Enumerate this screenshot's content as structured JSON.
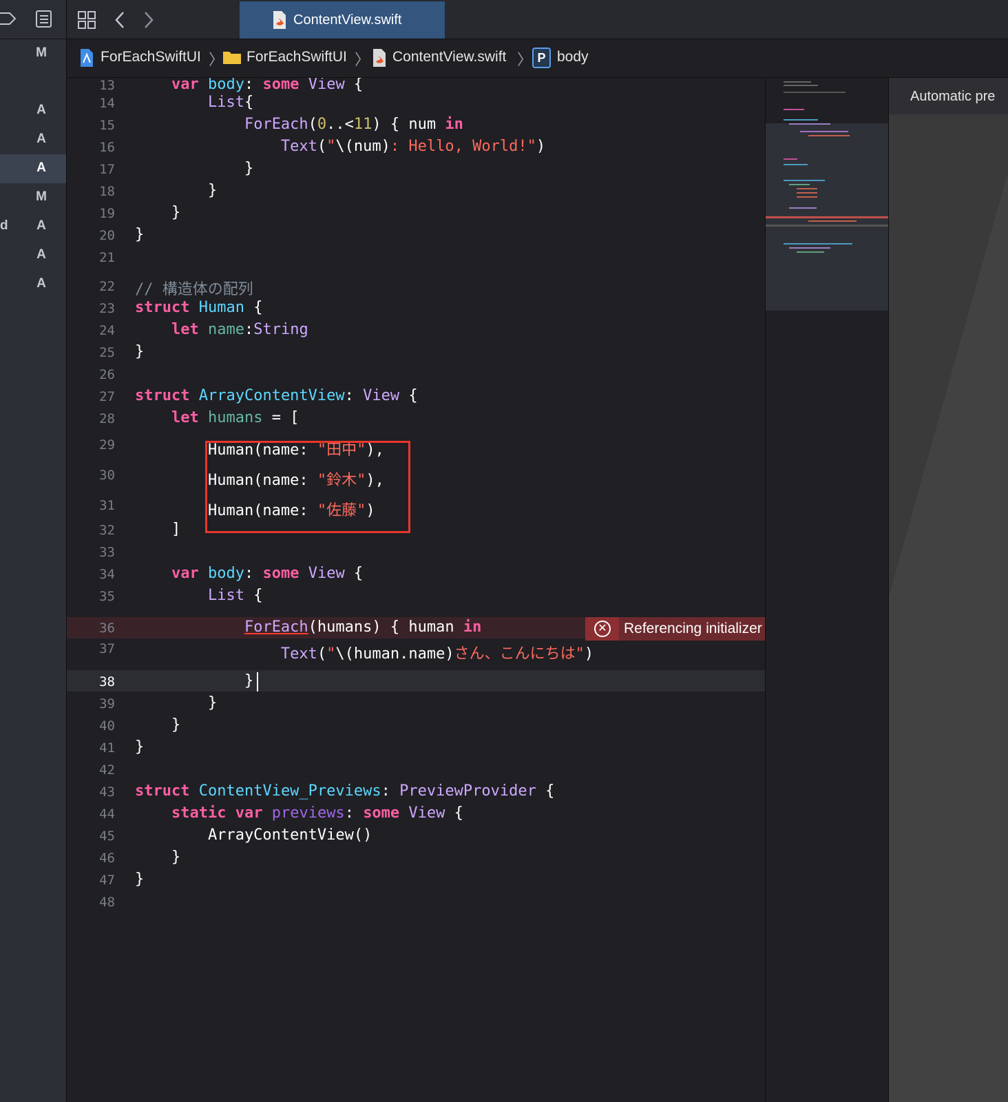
{
  "navigator": {
    "status_letters": [
      "M",
      "A",
      "A",
      "A",
      "M",
      "A",
      "A",
      "A"
    ],
    "fragment": "d"
  },
  "tab": {
    "title": "ContentView.swift"
  },
  "breadcrumb": {
    "project": "ForEachSwiftUI",
    "folder": "ForEachSwiftUI",
    "file": "ContentView.swift",
    "symbol_badge": "P",
    "symbol": "body"
  },
  "editor": {
    "line_numbers": [
      "13",
      "14",
      "15",
      "16",
      "17",
      "18",
      "19",
      "20",
      "21",
      "22",
      "23",
      "24",
      "25",
      "26",
      "27",
      "28",
      "29",
      "30",
      "31",
      "32",
      "33",
      "34",
      "35",
      "36",
      "37",
      "38",
      "39",
      "40",
      "41",
      "42",
      "43",
      "44",
      "45",
      "46",
      "47",
      "48"
    ],
    "current_line": "38",
    "error_line": "36",
    "error_message": "Referencing initializer 'init(..."
  },
  "canvas": {
    "label": "Automatic pre"
  },
  "colors": {
    "keyword": "#fc5fa3",
    "type": "#d0a8ff",
    "property": "#5dd8ff",
    "string": "#fc6a5d",
    "number": "#d0bf69",
    "comment": "#7f8c98",
    "error_bg": "#6c2a2e",
    "highlight_box": "#e8372b",
    "tab_active": "#33557e"
  }
}
